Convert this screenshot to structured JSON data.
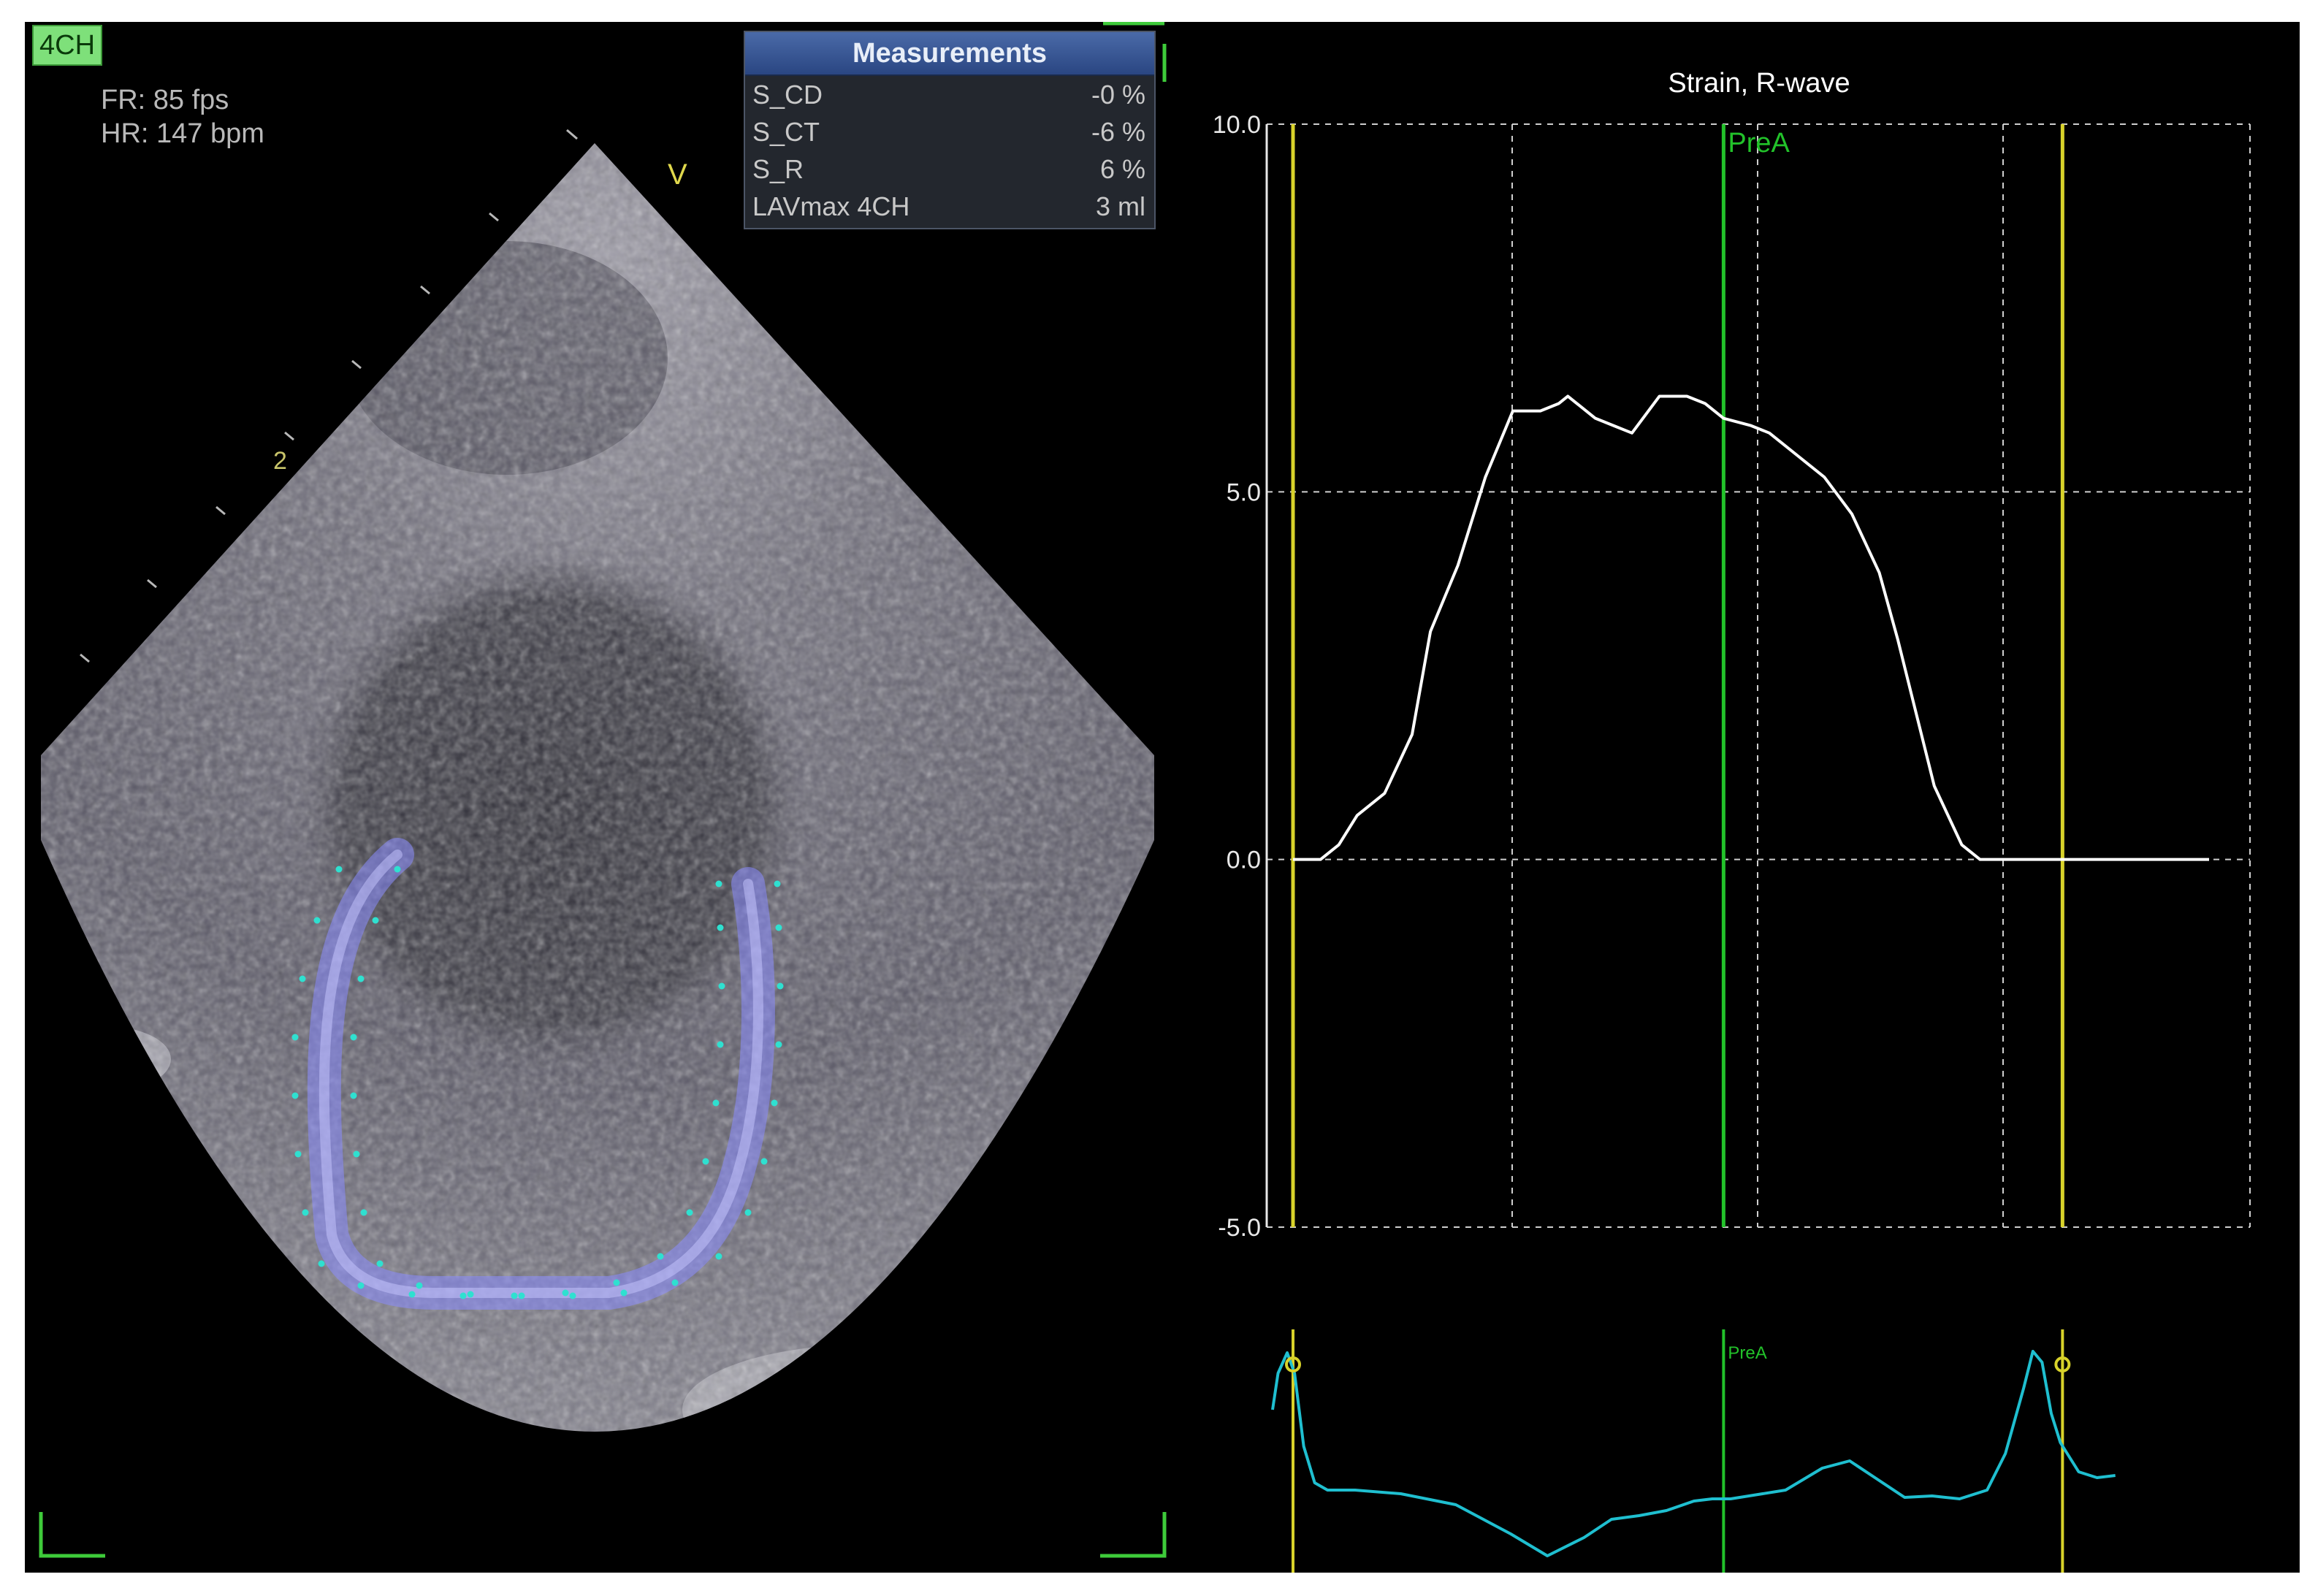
{
  "view": {
    "tag": "4CH",
    "frame_rate": "FR: 85 fps",
    "heart_rate": "HR: 147 bpm",
    "orientation_marker": "V",
    "depth_marker": "2"
  },
  "measurements": {
    "title": "Measurements",
    "rows": [
      {
        "label": "S_CD",
        "value": "-0 %"
      },
      {
        "label": "S_CT",
        "value": "-6 %"
      },
      {
        "label": "S_R",
        "value": "6 %"
      },
      {
        "label": "LAVmax 4CH",
        "value": "3 ml"
      }
    ]
  },
  "chart_data": {
    "type": "line",
    "title": "Strain, R-wave",
    "xlabel": "",
    "ylabel": "",
    "ylim": [
      -5.0,
      10.0
    ],
    "y_ticks": [
      "10.0",
      "5.0",
      "0.0",
      "-5.0"
    ],
    "grid": true,
    "xlim": [
      0,
      100
    ],
    "series": [
      {
        "x": [
          0,
          3,
          5,
          7,
          10,
          13,
          15,
          18,
          21,
          24,
          27,
          29,
          30,
          33,
          35,
          37,
          40,
          42,
          43,
          45,
          47,
          50,
          52,
          55,
          58,
          61,
          64,
          66,
          68,
          70,
          73,
          75,
          77,
          79,
          80,
          81,
          83,
          85,
          88,
          100
        ],
        "y": [
          0.0,
          0.0,
          0.2,
          0.6,
          0.9,
          1.7,
          3.1,
          4.0,
          5.2,
          6.1,
          6.1,
          6.2,
          6.3,
          6.0,
          5.9,
          5.8,
          6.3,
          6.3,
          6.3,
          6.2,
          6.0,
          5.9,
          5.8,
          5.5,
          5.2,
          4.7,
          3.9,
          3.0,
          2.0,
          1.0,
          0.2,
          0.0,
          0.0,
          0.0,
          0.0,
          0.0,
          0.0,
          0.0,
          0.0,
          0.0
        ],
        "color": "#ffffff"
      }
    ],
    "markers": [
      {
        "label": "",
        "x": 0,
        "color": "#d8d22a"
      },
      {
        "label": "PreA",
        "x": 47,
        "color": "#22c22a"
      },
      {
        "label": "",
        "x": 84,
        "color": "#d8d22a"
      }
    ]
  },
  "ecg": {
    "marker_label": "PreA",
    "color": "#1fbfd0"
  },
  "colors": {
    "background": "#000000",
    "accent_green": "#22c22a",
    "marker_yellow": "#d8d22a",
    "strain_trace": "#ffffff",
    "ecg_trace": "#1fbfd0",
    "tracking_roi": "#8a8cff"
  }
}
